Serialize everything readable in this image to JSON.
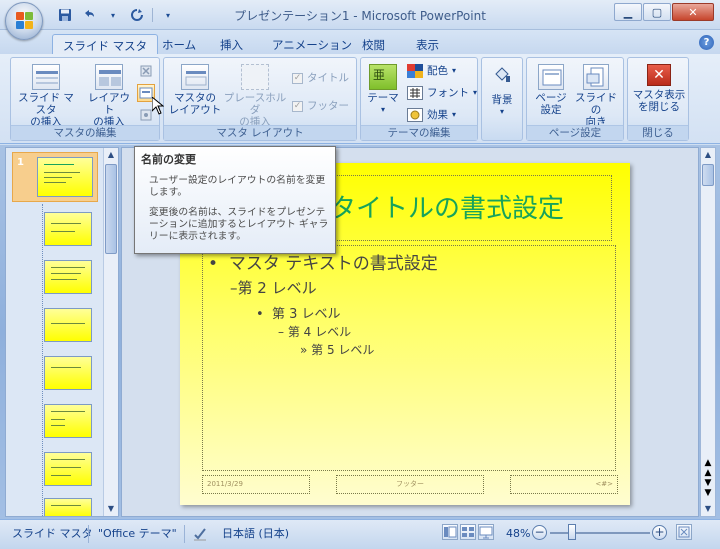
{
  "window": {
    "title": "プレゼンテーション1 - Microsoft PowerPoint"
  },
  "qat": {
    "save_icon": "save-icon",
    "undo_icon": "undo-icon",
    "redo_icon": "redo-icon"
  },
  "tabs": [
    {
      "label": "スライド マスタ",
      "active": true
    },
    {
      "label": "ホーム"
    },
    {
      "label": "挿入"
    },
    {
      "label": "アニメーション"
    },
    {
      "label": "校閲"
    },
    {
      "label": "表示"
    }
  ],
  "ribbon": {
    "groups": {
      "master_edit": "マスタの編集",
      "master_layout": "マスタ レイアウト",
      "theme_edit": "テーマの編集",
      "page_setup": "ページ設定",
      "close": "閉じる"
    },
    "insert_slide_master": [
      "スライド マスタ",
      "の挿入"
    ],
    "insert_layout": [
      "レイアウト",
      "の挿入"
    ],
    "master_layout_btn": [
      "マスタの",
      "レイアウト"
    ],
    "insert_placeholder": [
      "プレースホルダ",
      "の挿入"
    ],
    "title_check": "タイトル",
    "footer_check": "フッター",
    "theme": "テーマ",
    "colors": "配色",
    "fonts": "フォント",
    "effects": "効果",
    "background": "背景",
    "page_setup": [
      "ページ",
      "設定"
    ],
    "slide_orientation": [
      "スライドの",
      "向き"
    ],
    "close_master": [
      "マスタ表示",
      "を閉じる"
    ]
  },
  "thumbnails": {
    "master_number": "1"
  },
  "tooltip": {
    "title": "名前の変更",
    "line1": "ユーザー設定のレイアウトの名前を変更します。",
    "line2": "変更後の名前は、スライドをプレゼンテーションに追加するとレイアウト ギャラリーに表示されます。"
  },
  "slide": {
    "title": "タイトルの書式設定",
    "level1": "マスタ テキストの書式設定",
    "level2": "第 2 レベル",
    "level3": "第 3 レベル",
    "level4": "第 4 レベル",
    "level5": "第 5 レベル",
    "footer_date": "2011/3/29",
    "footer_center": "フッター",
    "footer_num": "<#>"
  },
  "status": {
    "view_name": "スライド マスタ",
    "theme_name": "\"Office テーマ\"",
    "language": "日本語 (日本)",
    "zoom": "48%",
    "zoom_value": 48
  }
}
